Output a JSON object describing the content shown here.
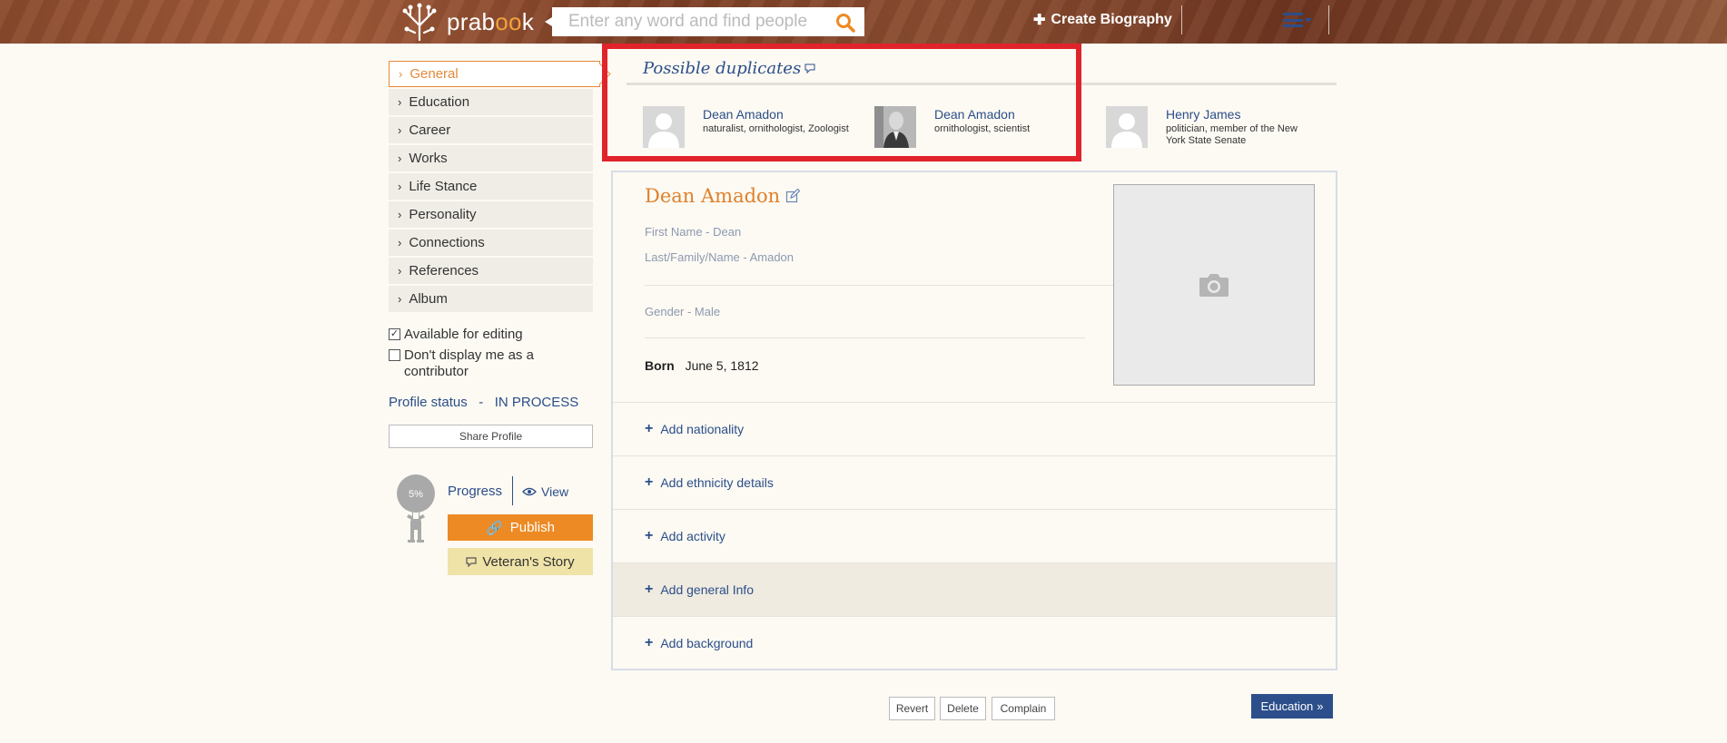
{
  "header": {
    "logo_text_a": "prab",
    "logo_text_b": "oo",
    "logo_text_c": "k",
    "search_placeholder": "Enter any word and find people",
    "create_label": "Create Biography"
  },
  "sidebar": {
    "items": [
      {
        "label": "General"
      },
      {
        "label": "Education"
      },
      {
        "label": "Career"
      },
      {
        "label": "Works"
      },
      {
        "label": "Life Stance"
      },
      {
        "label": "Personality"
      },
      {
        "label": "Connections"
      },
      {
        "label": "References"
      },
      {
        "label": "Album"
      }
    ],
    "available_editing": "Available for editing",
    "dont_display": "Don't display me as a contributor",
    "profile_status_label": "Profile status",
    "profile_status_value": "IN PROCESS",
    "share_label": "Share Profile",
    "progress_percent": "5%",
    "progress_label": "Progress",
    "view_label": "View",
    "publish_label": "Publish",
    "veteran_label": "Veteran's Story"
  },
  "duplicates": {
    "title": "Possible duplicates",
    "items": [
      {
        "name": "Dean Amadon",
        "desc": "naturalist, ornithologist, Zoologist"
      },
      {
        "name": "Dean Amadon",
        "desc": "ornithologist, scientist"
      },
      {
        "name": "Henry James",
        "desc": "politician, member of the New York State Senate"
      }
    ]
  },
  "profile": {
    "name": "Dean Amadon",
    "first_name": "First Name - Dean",
    "last_name": "Last/Family/Name - Amadon",
    "gender": "Gender - Male",
    "born_label": "Born",
    "born_value": "June 5, 1812",
    "add_rows": [
      "Add nationality",
      "Add ethnicity details",
      "Add activity",
      "Add general Info",
      "Add background"
    ]
  },
  "footer": {
    "revert": "Revert",
    "delete": "Delete",
    "complain": "Complain",
    "next": "Education"
  },
  "colors": {
    "accent_orange": "#e5893a",
    "link_blue": "#2c4e8a",
    "highlight_red": "#e1232b"
  }
}
